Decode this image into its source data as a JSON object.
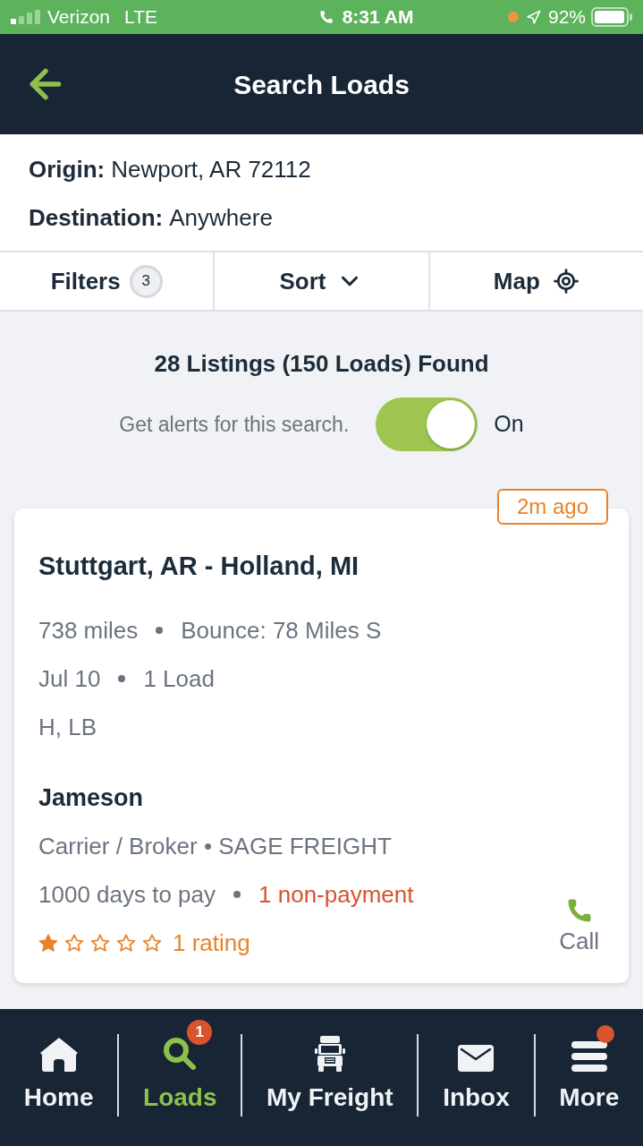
{
  "status_bar": {
    "carrier": "Verizon",
    "network": "LTE",
    "time": "8:31 AM",
    "battery": "92%"
  },
  "header": {
    "title": "Search Loads"
  },
  "search": {
    "fields": [
      {
        "label": "Origin:",
        "value": "Newport, AR 72112"
      },
      {
        "label": "Destination:",
        "value": "Anywhere"
      }
    ]
  },
  "toolbar": [
    {
      "kind": "filters",
      "label": "Filters",
      "count": "3"
    },
    {
      "kind": "sort",
      "label": "Sort"
    },
    {
      "kind": "map",
      "label": "Map"
    }
  ],
  "results": {
    "summary": "28 Listings (150 Loads) Found",
    "alerts": {
      "label": "Get alerts for this search.",
      "on": true,
      "state": "On"
    }
  },
  "listings": [
    {
      "age": "2m ago",
      "route": "Stuttgart, AR - Holland, MI",
      "details": [
        [
          "738 miles",
          "Bounce: 78 Miles S"
        ],
        [
          "Jul 10",
          "1 Load"
        ],
        [
          "H, LB"
        ]
      ],
      "contact": "Jameson",
      "company": "Carrier / Broker • SAGE FREIGHT",
      "payment_terms": "1000 days to pay",
      "non_payment": "1 non-payment",
      "stars": 1,
      "rating": "1 rating",
      "call": "Call"
    }
  ],
  "tab_bar": [
    {
      "kind": "home",
      "label": "Home",
      "selected": false,
      "dot": false
    },
    {
      "kind": "search",
      "label": "Loads",
      "selected": true,
      "dot": false,
      "badge": "1"
    },
    {
      "kind": "truck",
      "label": "My Freight",
      "selected": false,
      "dot": false
    },
    {
      "kind": "mail",
      "label": "Inbox",
      "selected": false,
      "dot": false
    },
    {
      "kind": "menu",
      "label": "More",
      "selected": false,
      "dot": true
    }
  ]
}
